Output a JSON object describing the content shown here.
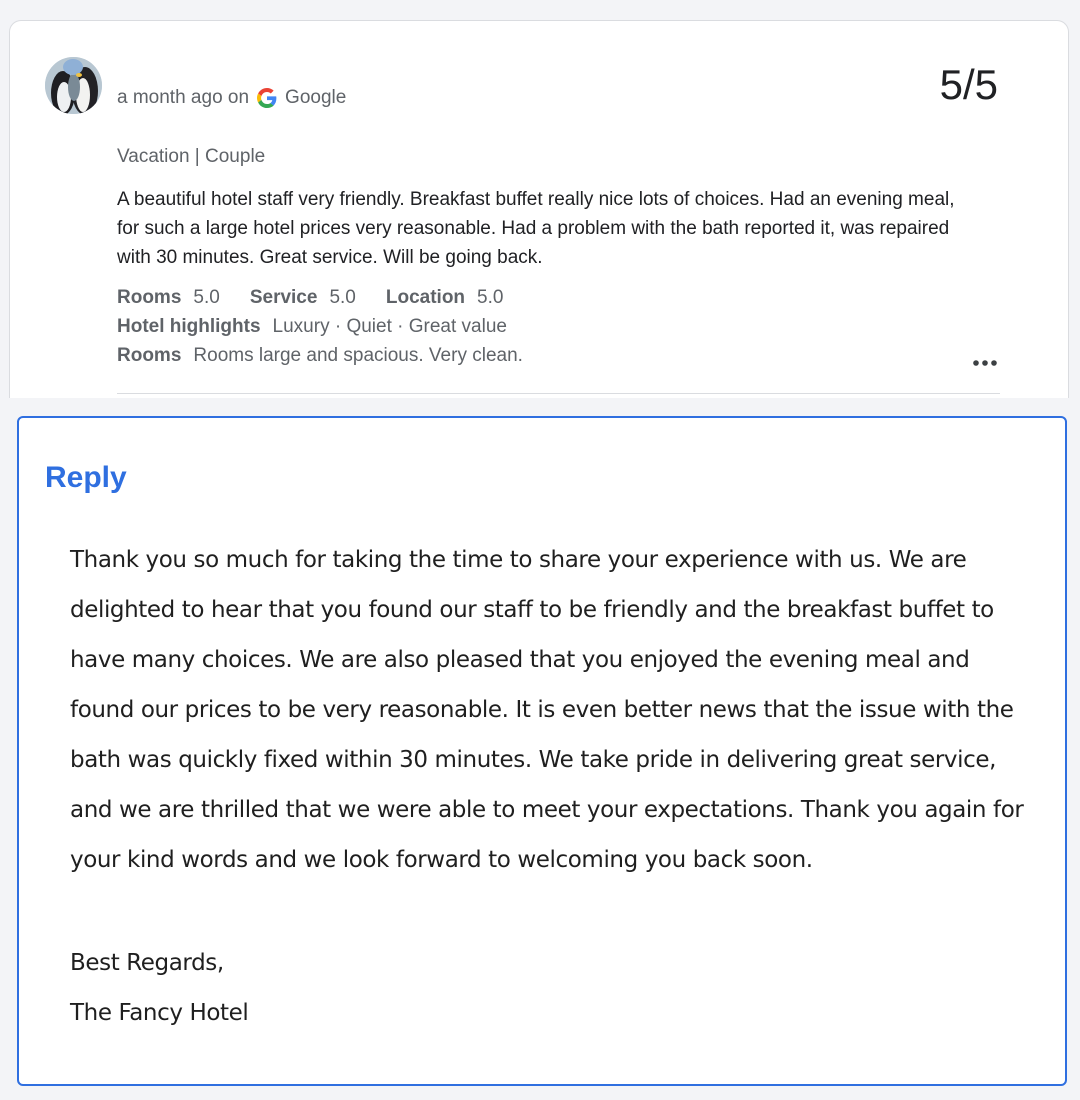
{
  "review": {
    "time_ago": "a month ago on",
    "source": "Google",
    "score": "5/5",
    "trip_type": "Vacation | Couple",
    "text": "A beautiful hotel staff very friendly. Breakfast buffet really nice lots of choices. Had an evening meal, for such a large hotel prices very reasonable. Had a problem with the bath reported it, was repaired with 30 minutes. Great service. Will be going back.",
    "ratings": [
      {
        "label": "Rooms",
        "value": "5.0"
      },
      {
        "label": "Service",
        "value": "5.0"
      },
      {
        "label": "Location",
        "value": "5.0"
      }
    ],
    "highlights_label": "Hotel highlights",
    "highlights_value": "Luxury · Quiet · Great value",
    "rooms_label": "Rooms",
    "rooms_value": "Rooms large and spacious. Very clean."
  },
  "reply": {
    "title": "Reply",
    "body": "Thank you so much for taking the time to share your experience with us. We are delighted to hear that you found our staff to be friendly and the breakfast buffet to have many choices. We are also pleased that you enjoyed the evening meal and found our prices to be very reasonable. It is even better news that the issue with the bath was quickly fixed within 30 minutes. We take pride in delivering great service, and we are thrilled that we were able to meet your expectations. Thank you again for your kind words and we look forward to welcoming you back soon.",
    "closing": "Best Regards,",
    "signature": "The Fancy Hotel"
  },
  "colors": {
    "accent": "#2f6fe0",
    "muted_text": "#5f6368",
    "text": "#202124"
  },
  "icons": {
    "avatar": "penguin-avatar",
    "source_logo": "google-g-icon",
    "more": "more-dots-icon"
  }
}
